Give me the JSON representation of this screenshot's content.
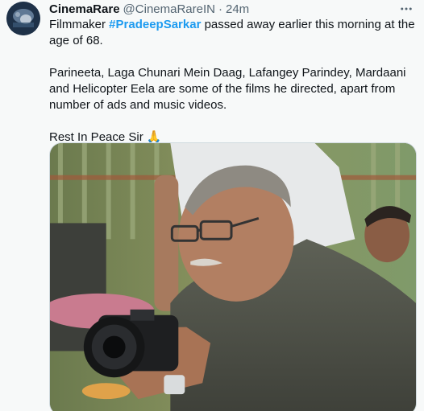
{
  "tweet": {
    "author_name": "CinemaRare",
    "handle": "@CinemaRareIN",
    "separator": "·",
    "time": "24m",
    "more_icon": "more-horizontal-icon",
    "text_line1_before": "Filmmaker ",
    "hashtag": "#PradeepSarkar",
    "text_line1_after": " passed away earlier this morning at the age of 68.",
    "paragraph2": "Parineeta, Laga Chunari Mein Daag, Lafangey Parindey, Mardaani and Helicopter Eela are some of the films he directed, apart from number of ads and music videos.",
    "paragraph3_text": "Rest In Peace Sir ",
    "paragraph3_emoji": "🙏",
    "media_alt": "photo"
  },
  "colors": {
    "background": "#f7f9f9",
    "hashtag": "#1d9bf0",
    "secondary_text": "#536471"
  }
}
